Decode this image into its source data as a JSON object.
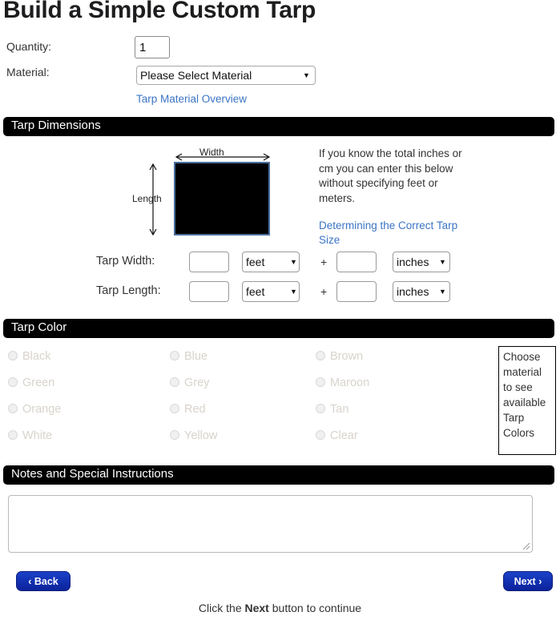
{
  "page_title": "Build a Simple Custom Tarp",
  "form": {
    "quantity_label": "Quantity:",
    "quantity_value": "1",
    "material_label": "Material:",
    "material_selected": "Please Select Material",
    "material_overview_link": "Tarp Material Overview"
  },
  "dimensions": {
    "section_title": "Tarp Dimensions",
    "diagram": {
      "width_label": "Width",
      "length_label": "Length"
    },
    "info_text": "If you know the total inches or cm you can enter this below without specifying feet or meters.",
    "size_link": "Determining the Correct Tarp Size",
    "plus": "+",
    "rows": [
      {
        "label": "Tarp Width:",
        "major_value": "",
        "major_unit": "feet",
        "minor_value": "",
        "minor_unit": "inches"
      },
      {
        "label": "Tarp Length:",
        "major_value": "",
        "major_unit": "feet",
        "minor_value": "",
        "minor_unit": "inches"
      }
    ]
  },
  "color": {
    "section_title": "Tarp Color",
    "options_col1": [
      "Black",
      "Green",
      "Orange",
      "White"
    ],
    "options_col2": [
      "Blue",
      "Grey",
      "Red",
      "Yellow"
    ],
    "options_col3": [
      "Brown",
      "Maroon",
      "Tan",
      "Clear"
    ],
    "hint_box": "Choose material to see available Tarp Colors"
  },
  "notes": {
    "section_title": "Notes and Special Instructions",
    "value": "",
    "placeholder": ""
  },
  "nav": {
    "back_label": "Back",
    "back_chevron": "‹",
    "next_label": "Next",
    "next_chevron": "›",
    "footer_prefix": "Click the ",
    "footer_bold": "Next",
    "footer_suffix": " button to continue"
  },
  "colors": {
    "accent_blue": "#1433b4",
    "link_blue": "#3b74c4",
    "bar_black": "#000000",
    "tarp_border": "#4a6f9c"
  }
}
